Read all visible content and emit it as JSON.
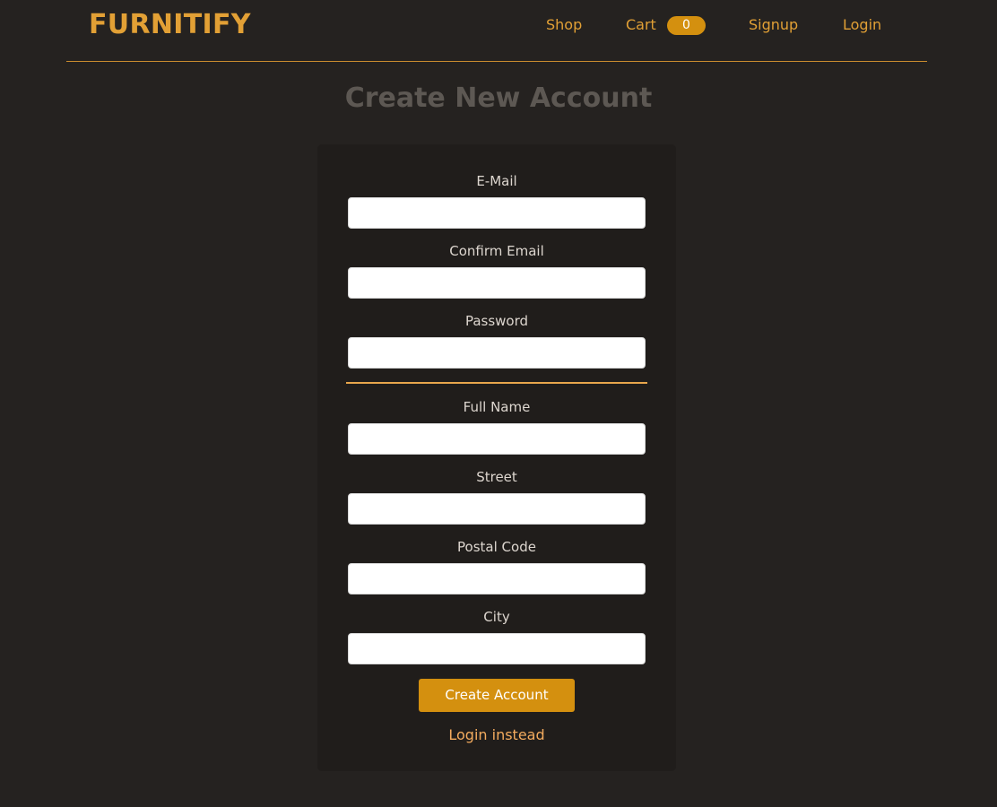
{
  "header": {
    "logo": "FURNITIFY",
    "nav": {
      "shop": "Shop",
      "cart": "Cart",
      "cart_count": "0",
      "signup": "Signup",
      "login": "Login"
    }
  },
  "page": {
    "title": "Create New Account"
  },
  "form": {
    "email_label": "E-Mail",
    "email_value": "",
    "confirm_email_label": "Confirm Email",
    "confirm_email_value": "",
    "password_label": "Password",
    "password_value": "",
    "full_name_label": "Full Name",
    "full_name_value": "",
    "street_label": "Street",
    "street_value": "",
    "postal_code_label": "Postal Code",
    "postal_code_value": "",
    "city_label": "City",
    "city_value": "",
    "submit_label": "Create Account",
    "alt_link": "Login instead"
  },
  "colors": {
    "background": "#252220",
    "card": "#201d1b",
    "accent": "#e2a035",
    "button": "#d4900f",
    "link": "#f3ab5e",
    "title": "#5d5853"
  }
}
